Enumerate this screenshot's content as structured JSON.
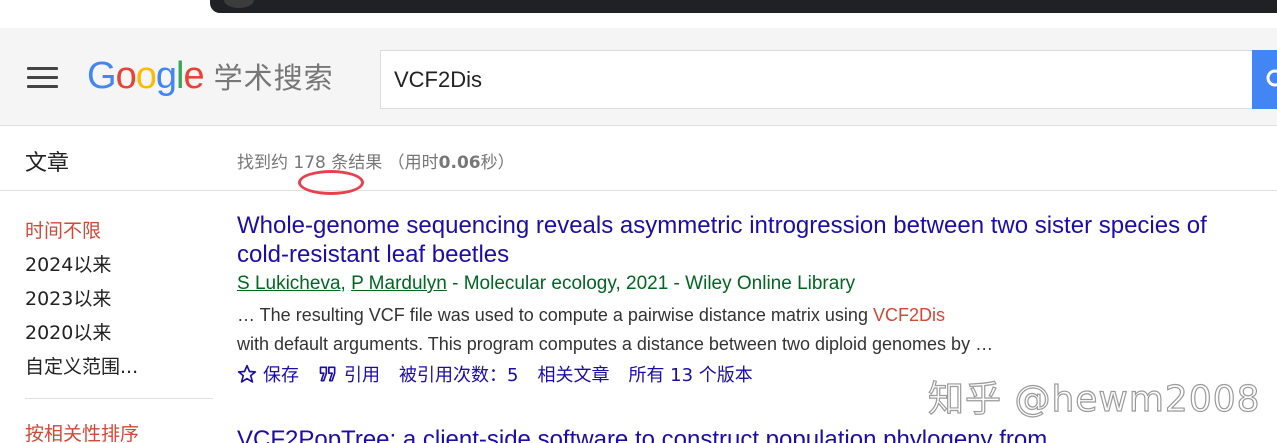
{
  "header": {
    "logo_letters": [
      {
        "char": "G",
        "color": "#4285f4"
      },
      {
        "char": "o",
        "color": "#ea4335"
      },
      {
        "char": "o",
        "color": "#fbbc05"
      },
      {
        "char": "g",
        "color": "#4285f4"
      },
      {
        "char": "l",
        "color": "#34a853"
      },
      {
        "char": "e",
        "color": "#ea4335"
      }
    ],
    "logo_suffix": "学术搜索",
    "search_value": "VCF2Dis"
  },
  "subbar": {
    "section_title": "文章",
    "stats_prefix": "找到约 178 条结果 （用时",
    "stats_time": "0.06",
    "stats_suffix": "秒）"
  },
  "sidebar": {
    "time_items": [
      "时间不限",
      "2024以来",
      "2023以来",
      "2020以来",
      "自定义范围..."
    ],
    "active_index": 0,
    "sort_label": "按相关性排序"
  },
  "results": [
    {
      "title": "Whole-genome sequencing reveals asymmetric introgression between two sister species of cold-resistant leaf beetles",
      "authors": [
        "S Lukicheva",
        "P Mardulyn"
      ],
      "source": " - Molecular ecology, 2021 - Wiley Online Library",
      "snippet_before": "… The resulting VCF file was used to compute a pairwise distance matrix using ",
      "snippet_highlight": "VCF2Dis",
      "snippet_after": " with default arguments. This program computes a distance between two diploid genomes by …",
      "actions": {
        "save": "保存",
        "cite": "引用",
        "cited_by": "被引用次数：5",
        "related": "相关文章",
        "versions": "所有 13 个版本"
      }
    }
  ],
  "next_result_title": "VCF2PopTree: a client-side software to construct population phylogeny from",
  "watermark": "知乎 @hewm2008",
  "colors": {
    "link": "#1a0dab",
    "author_green": "#006621",
    "highlight_red": "#d14836",
    "annotation_red": "#e8414e",
    "search_button": "#4285f4"
  }
}
